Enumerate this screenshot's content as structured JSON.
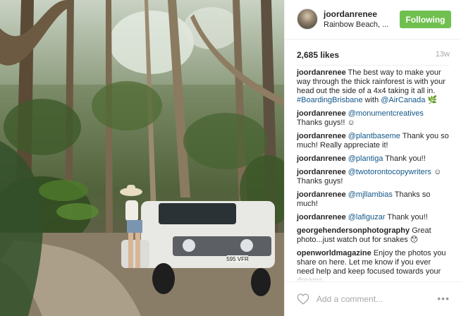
{
  "post": {
    "username": "joordanrenee",
    "location": "Rainbow Beach, ...",
    "follow_label": "Following",
    "likes": "2,685 likes",
    "time_ago": "13w",
    "photo_plate": "595 VFR"
  },
  "comments": [
    {
      "user": "joordanrenee",
      "parts": [
        {
          "t": "The best way to make your way through the thick rainforest is with your head out the side of a 4x4 taking it all in. "
        },
        {
          "t": "#BoardingBrisbane",
          "link": true
        },
        {
          "t": " with "
        },
        {
          "t": "@AirCanada",
          "link": true
        },
        {
          "t": " 🌿"
        }
      ]
    },
    {
      "user": "joordanrenee",
      "parts": [
        {
          "t": "@monumentcreatives",
          "link": true
        },
        {
          "t": " Thanks guys!! ☺"
        }
      ]
    },
    {
      "user": "joordanrenee",
      "parts": [
        {
          "t": "@plantbaseme",
          "link": true
        },
        {
          "t": " Thank you so much! Really appreciate it!"
        }
      ]
    },
    {
      "user": "joordanrenee",
      "parts": [
        {
          "t": "@plantiga",
          "link": true
        },
        {
          "t": " Thank you!!"
        }
      ]
    },
    {
      "user": "joordanrenee",
      "parts": [
        {
          "t": "@twotorontocopywriters",
          "link": true
        },
        {
          "t": " ☺ Thanks guys!"
        }
      ]
    },
    {
      "user": "joordanrenee",
      "parts": [
        {
          "t": "@mjllambias",
          "link": true
        },
        {
          "t": " Thanks so much!"
        }
      ]
    },
    {
      "user": "joordanrenee",
      "parts": [
        {
          "t": "@lafiguzar",
          "link": true
        },
        {
          "t": " Thank you!!"
        }
      ]
    },
    {
      "user": "georgehendersonphotography",
      "parts": [
        {
          "t": "Great photo...just watch out for snakes 😯"
        }
      ]
    },
    {
      "user": "openworldmagazine",
      "parts": [
        {
          "t": "Enjoy the photos you share on here. Let me know if you ever need help and keep focused towards your dreams"
        }
      ]
    }
  ],
  "footer": {
    "comment_placeholder": "Add a comment...",
    "more_label": "•••",
    "heart_icon": "heart-outline-icon",
    "more_icon": "ellipsis-icon"
  },
  "colors": {
    "follow_green": "#70c050",
    "link_blue": "#125688",
    "muted_gray": "#a5a7aa",
    "text_dark": "#262626"
  }
}
